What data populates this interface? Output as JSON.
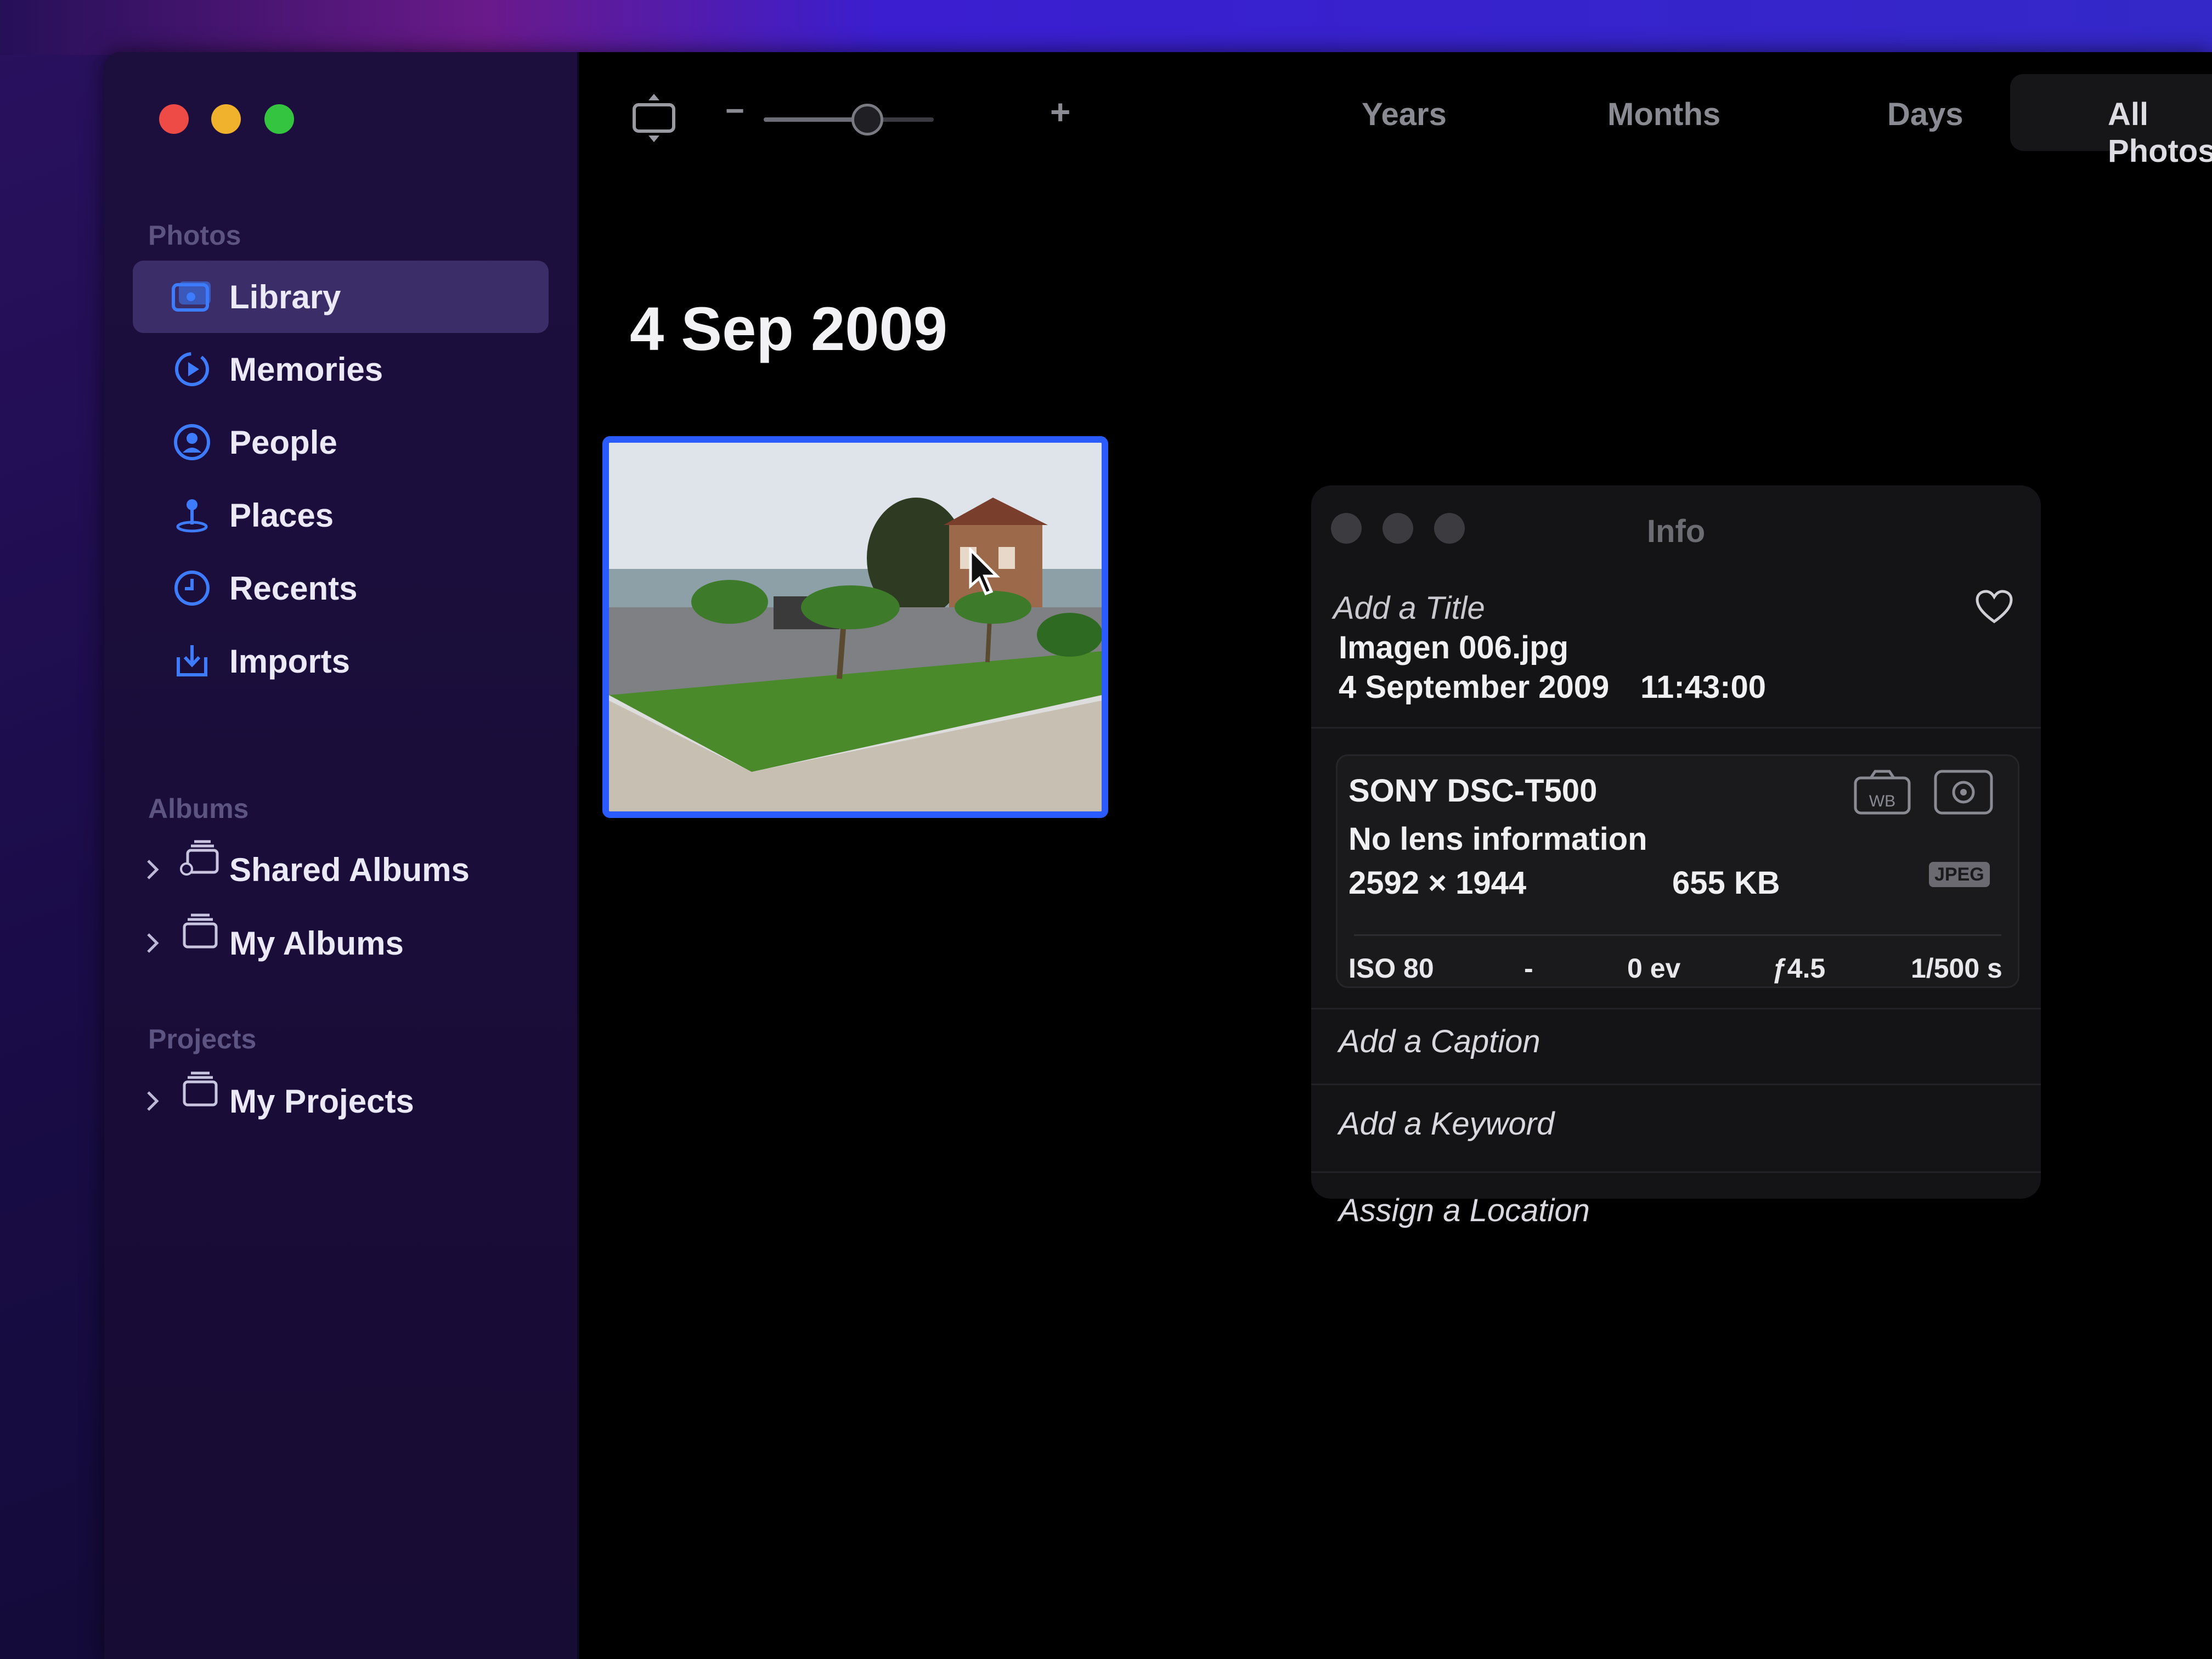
{
  "sidebar": {
    "sections": {
      "photos": "Photos",
      "albums": "Albums",
      "projects": "Projects"
    },
    "photos_items": [
      {
        "label": "Library",
        "icon": "library-icon",
        "selected": true
      },
      {
        "label": "Memories",
        "icon": "memories-icon"
      },
      {
        "label": "People",
        "icon": "people-icon"
      },
      {
        "label": "Places",
        "icon": "places-icon"
      },
      {
        "label": "Recents",
        "icon": "recents-icon"
      },
      {
        "label": "Imports",
        "icon": "imports-icon"
      }
    ],
    "albums_items": [
      {
        "label": "Shared Albums",
        "icon": "shared-albums-icon"
      },
      {
        "label": "My Albums",
        "icon": "albums-icon"
      }
    ],
    "projects_items": [
      {
        "label": "My Projects",
        "icon": "projects-icon"
      }
    ]
  },
  "toolbar": {
    "zoom_minus": "−",
    "zoom_plus": "+",
    "zoom_level": 0.62,
    "tabs": [
      {
        "label": "Years"
      },
      {
        "label": "Months"
      },
      {
        "label": "Days"
      },
      {
        "label": "All Photos",
        "active": true
      }
    ]
  },
  "main": {
    "date_header": "4 Sep 2009"
  },
  "info": {
    "title": "Info",
    "add_title": "Add a Title",
    "filename": "Imagen 006.jpg",
    "date": "4 September 2009",
    "time": "11:43:00",
    "camera": "SONY DSC-T500",
    "lens": "No lens information",
    "dimensions": "2592 × 1944",
    "filesize": "655 KB",
    "format_badge": "JPEG",
    "exif": {
      "iso": "ISO 80",
      "focal": "-",
      "exposure_comp": "0 ev",
      "aperture": "ƒ4.5",
      "shutter": "1/500 s"
    },
    "add_caption": "Add a Caption",
    "add_keyword": "Add a Keyword",
    "assign_location": "Assign a Location"
  },
  "colors": {
    "accent": "#2a5bff",
    "sidebar_icon": "#3d7bff",
    "selected_bg": "#3b2d68"
  }
}
